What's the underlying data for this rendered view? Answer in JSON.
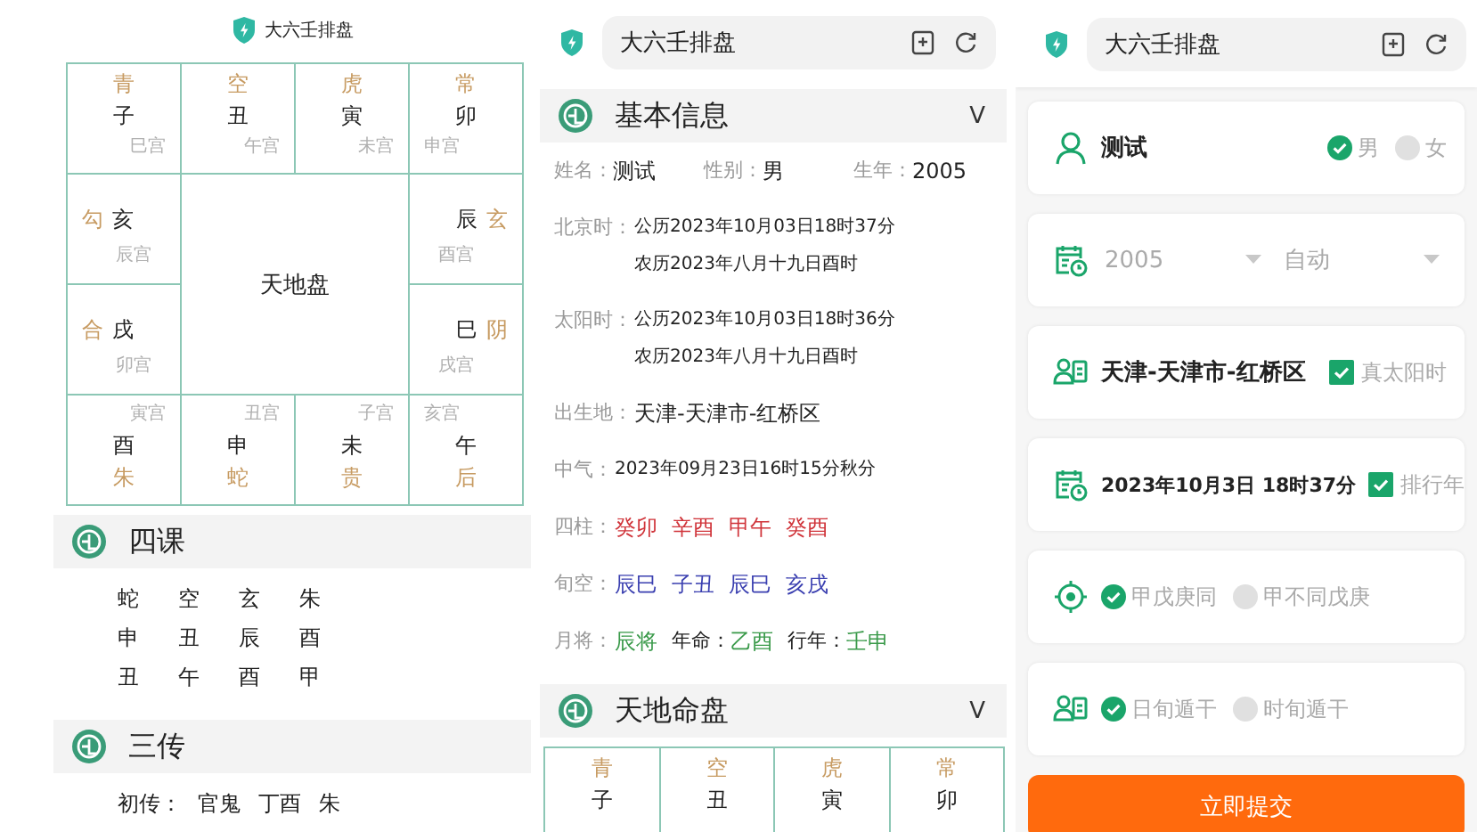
{
  "left": {
    "header": {
      "kind": "plain",
      "title": "大六壬排盘"
    },
    "board": {
      "center": "天地盘",
      "cells": [
        {
          "god": "青",
          "branch": "子",
          "palace": "巳宫"
        },
        {
          "god": "空",
          "branch": "丑",
          "palace": "午宫"
        },
        {
          "god": "虎",
          "branch": "寅",
          "palace": "未宫"
        },
        {
          "god": "常",
          "branch": "卯",
          "palace": "申宫"
        },
        {
          "god": "勾",
          "branch": "亥",
          "palace": "辰宫"
        },
        {
          "god": "玄",
          "branch": "辰",
          "palace": "酉宫"
        },
        {
          "god": "合",
          "branch": "戌",
          "palace": "卯宫"
        },
        {
          "god": "阴",
          "branch": "巳",
          "palace": "戌宫"
        },
        {
          "god": "朱",
          "branch": "酉",
          "palace": "寅宫"
        },
        {
          "god": "蛇",
          "branch": "申",
          "palace": "丑宫"
        },
        {
          "god": "贵",
          "branch": "未",
          "palace": "子宫"
        },
        {
          "god": "后",
          "branch": "午",
          "palace": "亥宫"
        }
      ]
    },
    "sections": [
      {
        "title": "四课",
        "rows": [
          [
            "蛇",
            "空",
            "玄",
            "朱"
          ],
          [
            "申",
            "丑",
            "辰",
            "酉"
          ],
          [
            "丑",
            "午",
            "酉",
            "甲"
          ]
        ]
      },
      {
        "title": "三传",
        "rows": [
          [
            "初传：",
            "官鬼",
            "丁酉",
            "朱"
          ]
        ]
      }
    ]
  },
  "middle": {
    "header": {
      "kind": "pill",
      "title": "大六壬排盘"
    },
    "sections": [
      {
        "title": "基本信息",
        "toggle": "V",
        "rows": [
          {
            "kind": "fields",
            "fields": [
              {
                "label": "姓名：",
                "value": "测试"
              },
              {
                "label": "性别：",
                "value": "男"
              },
              {
                "label": "生年：",
                "value": "2005"
              }
            ]
          },
          {
            "kind": "lines",
            "label": "北京时：",
            "lines": [
              "公历2023年10月03日18时37分",
              "农历2023年八月十九日酉时"
            ]
          },
          {
            "kind": "lines",
            "label": "太阳时：",
            "lines": [
              "公历2023年10月03日18时36分",
              "农历2023年八月十九日酉时"
            ]
          },
          {
            "kind": "text",
            "label": "出生地：",
            "value": "天津-天津市-红桥区"
          },
          {
            "kind": "lines",
            "label": "中气：",
            "lines": [
              "2023年09月23日16时15分秋分"
            ]
          },
          {
            "kind": "tokens",
            "label": "四柱：",
            "color": "#d0343a",
            "tokens": [
              "癸卯",
              "辛酉",
              "甲午",
              "癸酉"
            ]
          },
          {
            "kind": "tokens",
            "label": "旬空：",
            "color": "#3a3fb0",
            "tokens": [
              "辰巳",
              "子丑",
              "辰巳",
              "亥戌"
            ]
          },
          {
            "kind": "fields",
            "label": "月将：",
            "color": "#3a9a4a",
            "fields": [
              {
                "value": "辰将"
              },
              {
                "label": "年命：",
                "value": "乙酉"
              },
              {
                "label": "行年：",
                "value": "壬申"
              }
            ]
          }
        ]
      },
      {
        "title": "天地命盘",
        "toggle": "V",
        "board": {
          "cells": [
            {
              "god": "青",
              "branch": "子"
            },
            {
              "god": "空",
              "branch": "丑"
            },
            {
              "god": "虎",
              "branch": "寅"
            },
            {
              "god": "常",
              "branch": "卯"
            }
          ]
        }
      }
    ]
  },
  "right": {
    "header": {
      "kind": "pill",
      "title": "大六壬排盘"
    },
    "cards": [
      {
        "kind": "name",
        "value": "测试",
        "options": [
          {
            "label": "男",
            "selected": true
          },
          {
            "label": "女",
            "selected": false
          }
        ]
      },
      {
        "kind": "selects",
        "selects": [
          {
            "value": "2005"
          },
          {
            "value": "自动"
          }
        ]
      },
      {
        "kind": "place",
        "value": "天津-天津市-红桥区",
        "check": {
          "label": "真太阳时",
          "checked": true
        }
      },
      {
        "kind": "date",
        "value": "2023年10月3日 18时37分",
        "check": {
          "label": "排行年",
          "checked": true
        }
      },
      {
        "kind": "radios",
        "options": [
          {
            "label": "甲戊庚同",
            "selected": true
          },
          {
            "label": "甲不同戊庚",
            "selected": false
          }
        ]
      },
      {
        "kind": "radios",
        "options": [
          {
            "label": "日旬遁干",
            "selected": true
          },
          {
            "label": "时旬遁干",
            "selected": false
          }
        ]
      }
    ],
    "submit": "立即提交"
  }
}
